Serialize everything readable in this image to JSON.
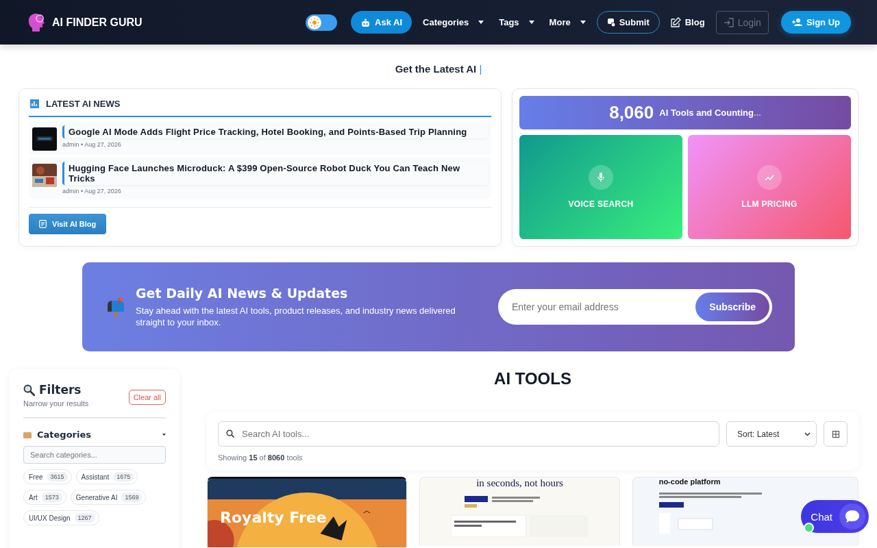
{
  "header": {
    "brand": "AI FINDER GURU",
    "dark_mode": false,
    "nav": [
      {
        "kind": "primary",
        "label": "Ask AI"
      },
      {
        "kind": "dropdown",
        "label": "Categories"
      },
      {
        "kind": "dropdown",
        "label": "Tags"
      },
      {
        "kind": "dropdown",
        "label": "More"
      },
      {
        "kind": "outline",
        "label": "Submit"
      },
      {
        "kind": "link",
        "label": "Blog"
      },
      {
        "kind": "ghost",
        "label": "Login"
      },
      {
        "kind": "signup",
        "label": "Sign Up"
      }
    ]
  },
  "tagline": {
    "text": "Get the Latest AI",
    "cursor": "|"
  },
  "news": {
    "title": "LATEST AI NEWS",
    "items": [
      {
        "title": "Google AI Mode Adds Flight Price Tracking, Hotel Booking, and Points-Based Trip Planning",
        "author": "admin",
        "separator": "•",
        "date": "Aug 27, 2026"
      },
      {
        "title": "Hugging Face Launches Microduck: A $399 Open-Source Robot Duck You Can Teach New Tricks",
        "author": "admin",
        "separator": "•",
        "date": "Aug 27, 2026"
      }
    ],
    "button": "Visit AI Blog"
  },
  "stats": {
    "count": "8,060",
    "label": "AI Tools and Counting",
    "ellipsis": "...",
    "tiles": [
      {
        "kind": "voice",
        "label": "VOICE SEARCH"
      },
      {
        "kind": "pricing",
        "label": "LLM PRICING"
      }
    ]
  },
  "newsletter": {
    "title": "Get Daily AI News & Updates",
    "text": "Stay ahead with the latest AI tools, product releases, and industry news delivered straight to your inbox.",
    "placeholder": "Enter your email address",
    "button": "Subscribe"
  },
  "filters": {
    "title": "Filters",
    "subtitle": "Narrow your results",
    "clear": "Clear all",
    "section": {
      "title": "Categories",
      "expanded": true,
      "placeholder": "Search categories...",
      "chips": [
        {
          "label": "Free",
          "count": "3615"
        },
        {
          "label": "Assistant",
          "count": "1675"
        },
        {
          "label": "Art",
          "count": "1573"
        },
        {
          "label": "Generative AI",
          "count": "1569"
        },
        {
          "label": "UI/UX Design",
          "count": "1267"
        }
      ]
    }
  },
  "tools": {
    "title": "AI TOOLS",
    "placeholder": "Search AI tools...",
    "sort": "Sort: Latest",
    "showing": [
      "Showing",
      "15",
      "of",
      "8060",
      "tools"
    ],
    "cards": [
      {
        "kind": "picture",
        "headline": "Royalty Free"
      },
      {
        "kind": "site",
        "headline": "in seconds, not hours"
      },
      {
        "kind": "site",
        "headline": "no-code platform"
      }
    ]
  },
  "chat": {
    "label": "Chat"
  }
}
